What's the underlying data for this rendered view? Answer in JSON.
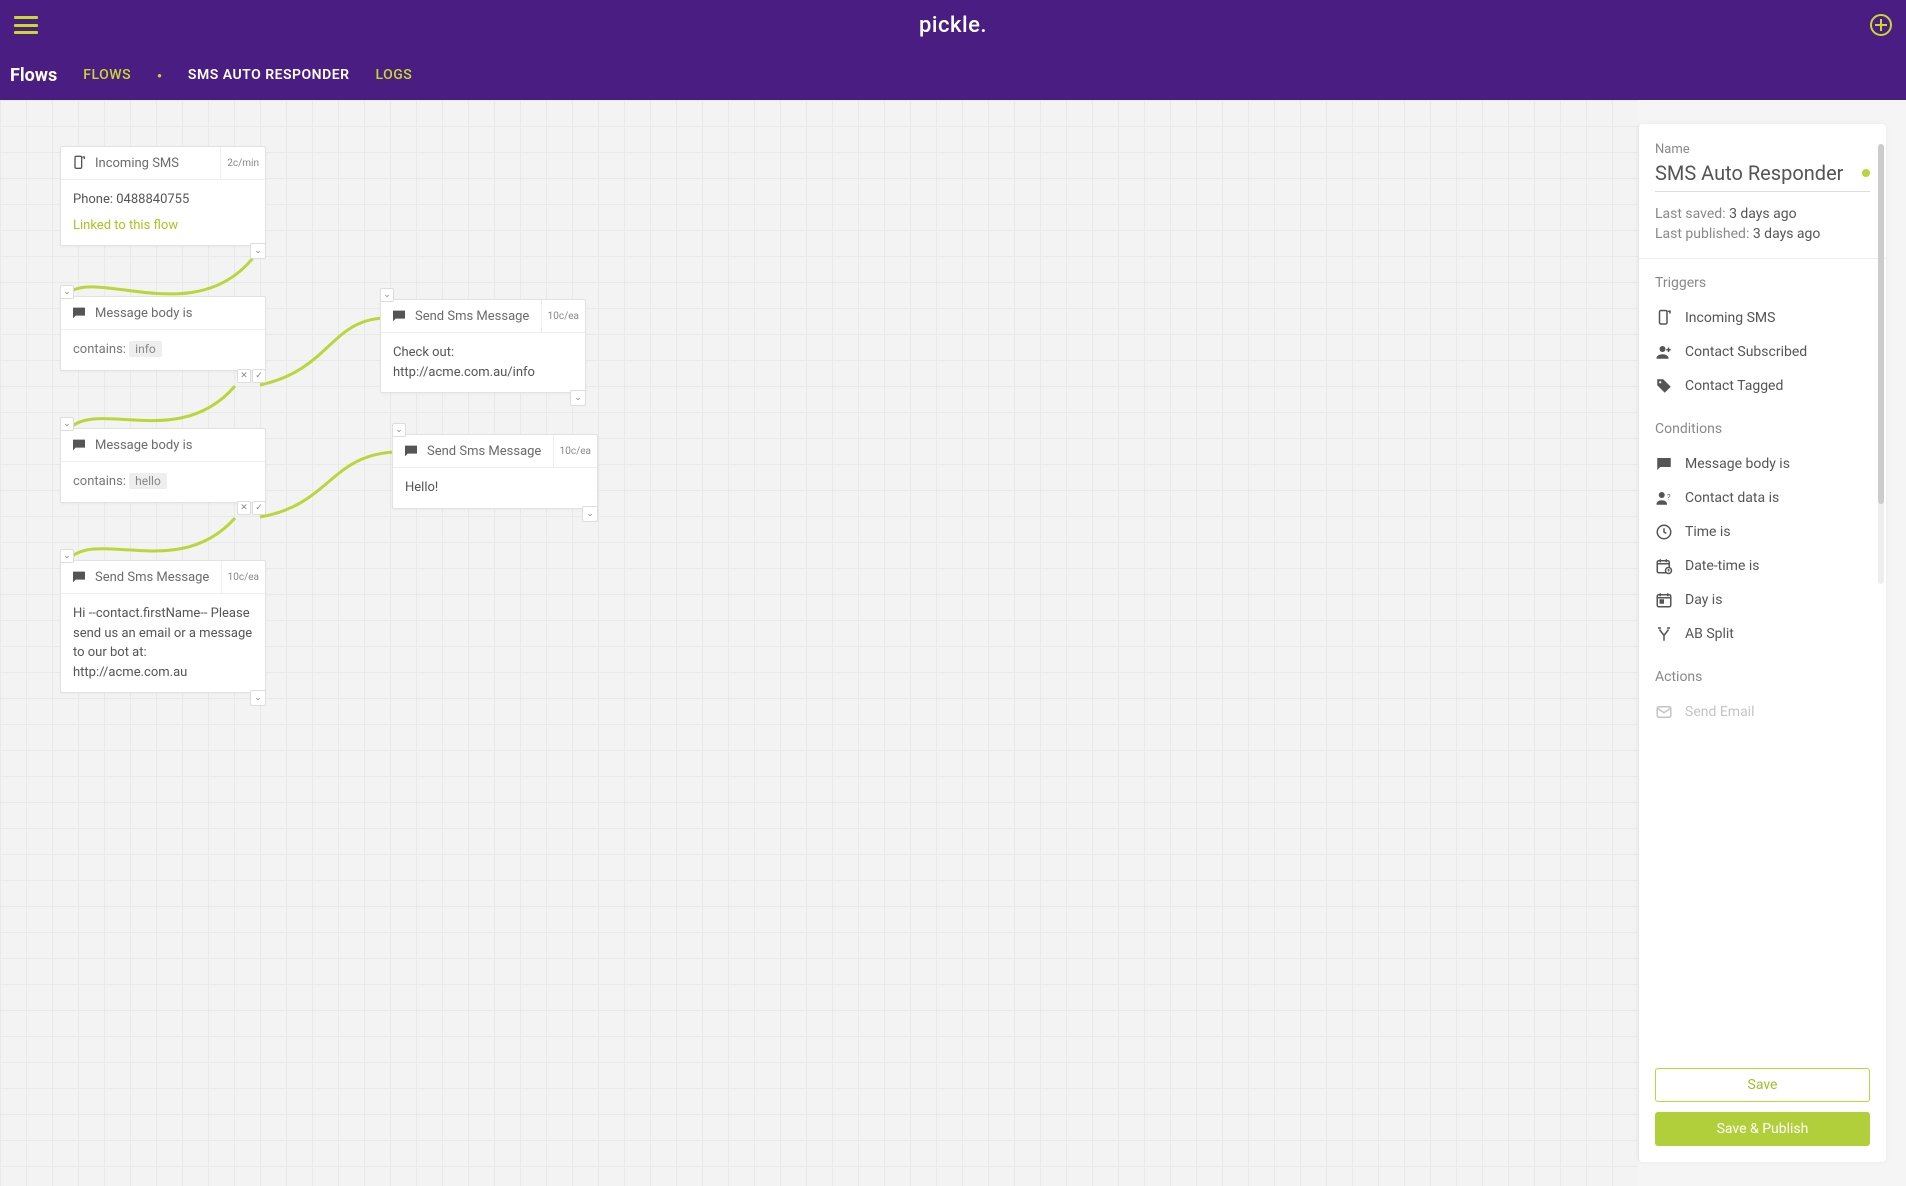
{
  "brand": "pickle.",
  "header": {
    "section": "Flows",
    "breadcrumbs": [
      "FLOWS"
    ],
    "current": "SMS AUTO RESPONDER",
    "logs": "LOGS"
  },
  "canvas": {
    "nodes": {
      "incoming": {
        "title": "Incoming SMS",
        "cost": "2c/min",
        "phone_label": "Phone:",
        "phone_value": "0488840755",
        "linked": "Linked to this flow"
      },
      "cond_info": {
        "title": "Message body is",
        "op": "contains:",
        "value": "info"
      },
      "send_info": {
        "title": "Send Sms Message",
        "cost": "10c/ea",
        "body": "Check out: http://acme.com.au/info"
      },
      "cond_hello": {
        "title": "Message body is",
        "op": "contains:",
        "value": "hello"
      },
      "send_hello": {
        "title": "Send Sms Message",
        "cost": "10c/ea",
        "body": "Hello!"
      },
      "send_fallback": {
        "title": "Send Sms Message",
        "cost": "10c/ea",
        "body": "Hi --contact.firstName-- Please send us an email or a message to our bot at: http://acme.com.au"
      }
    }
  },
  "panel": {
    "name_label": "Name",
    "name_value": "SMS Auto Responder",
    "meta": {
      "last_saved_label": "Last saved:",
      "last_saved_value": "3 days ago",
      "last_published_label": "Last published:",
      "last_published_value": "3 days ago"
    },
    "groups": {
      "triggers_title": "Triggers",
      "triggers": [
        {
          "icon": "sms-in",
          "label": "Incoming SMS"
        },
        {
          "icon": "sub",
          "label": "Contact Subscribed"
        },
        {
          "icon": "tag",
          "label": "Contact Tagged"
        }
      ],
      "conditions_title": "Conditions",
      "conditions": [
        {
          "icon": "msg",
          "label": "Message body is"
        },
        {
          "icon": "person-q",
          "label": "Contact data is"
        },
        {
          "icon": "clock",
          "label": "Time is"
        },
        {
          "icon": "cal-clock",
          "label": "Date-time is"
        },
        {
          "icon": "cal-day",
          "label": "Day is"
        },
        {
          "icon": "split",
          "label": "AB Split"
        }
      ],
      "actions_title": "Actions",
      "actions": [
        {
          "icon": "mail",
          "label": "Send Email"
        }
      ]
    },
    "buttons": {
      "save": "Save",
      "publish": "Save & Publish"
    }
  }
}
